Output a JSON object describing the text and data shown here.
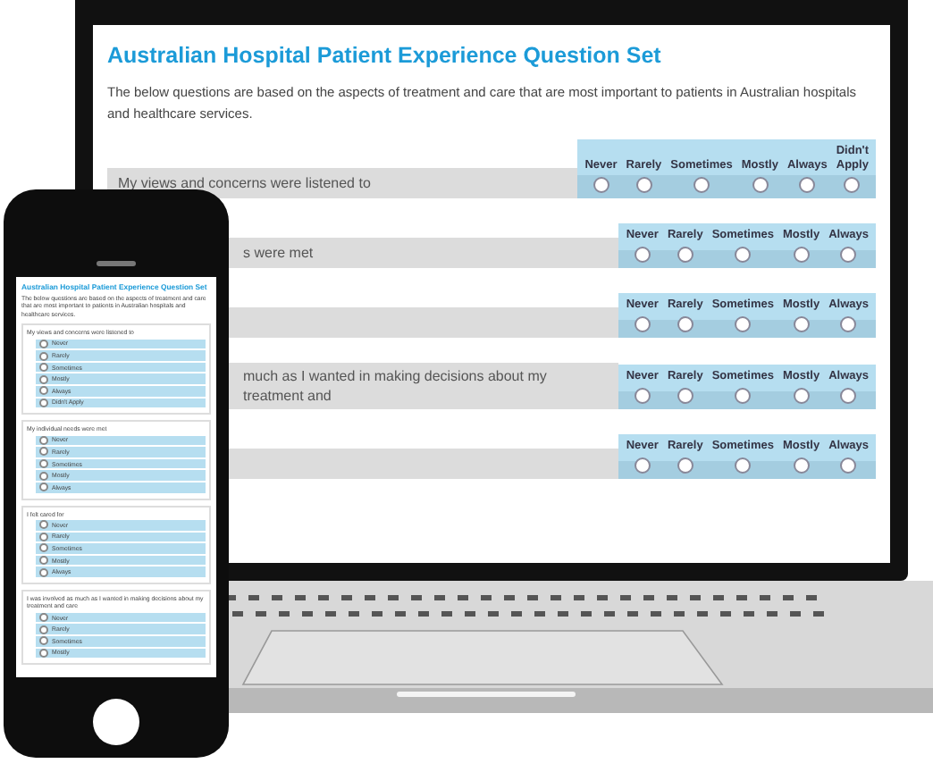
{
  "laptop": {
    "title": "Australian Hospital Patient Experience Question Set",
    "intro": "The below questions are based on the aspects of treatment and care that are most important to patients in Australian hospitals and healthcare services.",
    "questions": [
      {
        "text": "My views and concerns were listened to",
        "options": [
          {
            "label": "Never",
            "selected": false
          },
          {
            "label": "Rarely",
            "selected": false
          },
          {
            "label": "Sometimes",
            "selected": false
          },
          {
            "label": "Mostly",
            "selected": false
          },
          {
            "label": "Always",
            "selected": false
          },
          {
            "label": "Didn't Apply",
            "selected": false
          }
        ]
      },
      {
        "text": "s were met",
        "options": [
          {
            "label": "Never",
            "selected": false
          },
          {
            "label": "Rarely",
            "selected": false
          },
          {
            "label": "Sometimes",
            "selected": false
          },
          {
            "label": "Mostly",
            "selected": false
          },
          {
            "label": "Always",
            "selected": false
          }
        ]
      },
      {
        "options": [
          {
            "label": "Never",
            "selected": false
          },
          {
            "label": "Rarely",
            "selected": false
          },
          {
            "label": "Sometimes",
            "selected": false
          },
          {
            "label": "Mostly",
            "selected": false
          },
          {
            "label": "Always",
            "selected": false
          }
        ]
      },
      {
        "text": "much as I wanted in making decisions about my treatment and",
        "options": [
          {
            "label": "Never",
            "selected": false
          },
          {
            "label": "Rarely",
            "selected": false
          },
          {
            "label": "Sometimes",
            "selected": false
          },
          {
            "label": "Mostly",
            "selected": false
          },
          {
            "label": "Always",
            "selected": false
          }
        ]
      },
      {
        "options": [
          {
            "label": "Never",
            "selected": false
          },
          {
            "label": "Rarely",
            "selected": false
          },
          {
            "label": "Sometimes",
            "selected": false
          },
          {
            "label": "Mostly",
            "selected": false
          },
          {
            "label": "Always",
            "selected": false
          }
        ]
      }
    ]
  },
  "phone": {
    "title": "Australian Hospital Patient Experience Question Set",
    "intro": "The below questions are based on the aspects of treatment and care that are most important to patients in Australian hospitals and healthcare services.",
    "questions": [
      {
        "text": "My views and concerns were listened to",
        "options": [
          {
            "label": "Never",
            "selected": false
          },
          {
            "label": "Rarely",
            "selected": false
          },
          {
            "label": "Sometimes",
            "selected": false
          },
          {
            "label": "Mostly",
            "selected": false
          },
          {
            "label": "Always",
            "selected": false
          },
          {
            "label": "Didn't Apply",
            "selected": false
          }
        ]
      },
      {
        "text": "My individual needs were met",
        "options": [
          {
            "label": "Never",
            "selected": false
          },
          {
            "label": "Rarely",
            "selected": false
          },
          {
            "label": "Sometimes",
            "selected": false
          },
          {
            "label": "Mostly",
            "selected": false
          },
          {
            "label": "Always",
            "selected": false
          }
        ]
      },
      {
        "text": "I felt cared for",
        "options": [
          {
            "label": "Never",
            "selected": false
          },
          {
            "label": "Rarely",
            "selected": false
          },
          {
            "label": "Sometimes",
            "selected": false
          },
          {
            "label": "Mostly",
            "selected": false
          },
          {
            "label": "Always",
            "selected": false
          }
        ]
      },
      {
        "text": "I was involved as much as I wanted in making decisions about my treatment and care",
        "options": [
          {
            "label": "Never",
            "selected": false
          },
          {
            "label": "Rarely",
            "selected": false
          },
          {
            "label": "Sometimes",
            "selected": false
          },
          {
            "label": "Mostly",
            "selected": false
          }
        ]
      }
    ]
  }
}
